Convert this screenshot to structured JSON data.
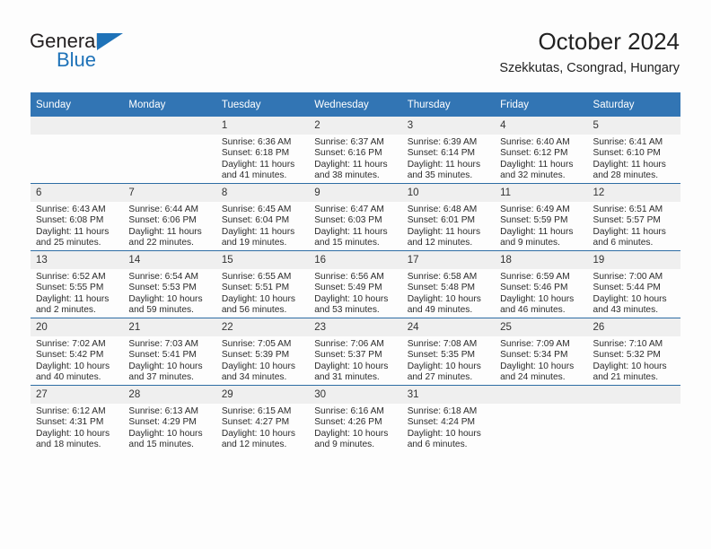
{
  "brand": {
    "name_top": "General",
    "name_bottom": "Blue",
    "accent_color": "#1e72b8"
  },
  "header": {
    "title": "October 2024",
    "subtitle": "Szekkutas, Csongrad, Hungary"
  },
  "theme": {
    "header_bg": "#3275b4",
    "row_divider": "#2e6da4",
    "daynum_bg": "#efefef",
    "page_bg": "#fdfdfd"
  },
  "labels": {
    "sunrise_prefix": "Sunrise:",
    "sunset_prefix": "Sunset:",
    "daylight_prefix": "Daylight:"
  },
  "weekdays": [
    "Sunday",
    "Monday",
    "Tuesday",
    "Wednesday",
    "Thursday",
    "Friday",
    "Saturday"
  ],
  "weeks": [
    [
      {
        "day": "",
        "sunrise": "",
        "sunset": "",
        "daylight_line1": "",
        "daylight_line2": ""
      },
      {
        "day": "",
        "sunrise": "",
        "sunset": "",
        "daylight_line1": "",
        "daylight_line2": ""
      },
      {
        "day": "1",
        "sunrise": "Sunrise: 6:36 AM",
        "sunset": "Sunset: 6:18 PM",
        "daylight_line1": "Daylight: 11 hours",
        "daylight_line2": "and 41 minutes."
      },
      {
        "day": "2",
        "sunrise": "Sunrise: 6:37 AM",
        "sunset": "Sunset: 6:16 PM",
        "daylight_line1": "Daylight: 11 hours",
        "daylight_line2": "and 38 minutes."
      },
      {
        "day": "3",
        "sunrise": "Sunrise: 6:39 AM",
        "sunset": "Sunset: 6:14 PM",
        "daylight_line1": "Daylight: 11 hours",
        "daylight_line2": "and 35 minutes."
      },
      {
        "day": "4",
        "sunrise": "Sunrise: 6:40 AM",
        "sunset": "Sunset: 6:12 PM",
        "daylight_line1": "Daylight: 11 hours",
        "daylight_line2": "and 32 minutes."
      },
      {
        "day": "5",
        "sunrise": "Sunrise: 6:41 AM",
        "sunset": "Sunset: 6:10 PM",
        "daylight_line1": "Daylight: 11 hours",
        "daylight_line2": "and 28 minutes."
      }
    ],
    [
      {
        "day": "6",
        "sunrise": "Sunrise: 6:43 AM",
        "sunset": "Sunset: 6:08 PM",
        "daylight_line1": "Daylight: 11 hours",
        "daylight_line2": "and 25 minutes."
      },
      {
        "day": "7",
        "sunrise": "Sunrise: 6:44 AM",
        "sunset": "Sunset: 6:06 PM",
        "daylight_line1": "Daylight: 11 hours",
        "daylight_line2": "and 22 minutes."
      },
      {
        "day": "8",
        "sunrise": "Sunrise: 6:45 AM",
        "sunset": "Sunset: 6:04 PM",
        "daylight_line1": "Daylight: 11 hours",
        "daylight_line2": "and 19 minutes."
      },
      {
        "day": "9",
        "sunrise": "Sunrise: 6:47 AM",
        "sunset": "Sunset: 6:03 PM",
        "daylight_line1": "Daylight: 11 hours",
        "daylight_line2": "and 15 minutes."
      },
      {
        "day": "10",
        "sunrise": "Sunrise: 6:48 AM",
        "sunset": "Sunset: 6:01 PM",
        "daylight_line1": "Daylight: 11 hours",
        "daylight_line2": "and 12 minutes."
      },
      {
        "day": "11",
        "sunrise": "Sunrise: 6:49 AM",
        "sunset": "Sunset: 5:59 PM",
        "daylight_line1": "Daylight: 11 hours",
        "daylight_line2": "and 9 minutes."
      },
      {
        "day": "12",
        "sunrise": "Sunrise: 6:51 AM",
        "sunset": "Sunset: 5:57 PM",
        "daylight_line1": "Daylight: 11 hours",
        "daylight_line2": "and 6 minutes."
      }
    ],
    [
      {
        "day": "13",
        "sunrise": "Sunrise: 6:52 AM",
        "sunset": "Sunset: 5:55 PM",
        "daylight_line1": "Daylight: 11 hours",
        "daylight_line2": "and 2 minutes."
      },
      {
        "day": "14",
        "sunrise": "Sunrise: 6:54 AM",
        "sunset": "Sunset: 5:53 PM",
        "daylight_line1": "Daylight: 10 hours",
        "daylight_line2": "and 59 minutes."
      },
      {
        "day": "15",
        "sunrise": "Sunrise: 6:55 AM",
        "sunset": "Sunset: 5:51 PM",
        "daylight_line1": "Daylight: 10 hours",
        "daylight_line2": "and 56 minutes."
      },
      {
        "day": "16",
        "sunrise": "Sunrise: 6:56 AM",
        "sunset": "Sunset: 5:49 PM",
        "daylight_line1": "Daylight: 10 hours",
        "daylight_line2": "and 53 minutes."
      },
      {
        "day": "17",
        "sunrise": "Sunrise: 6:58 AM",
        "sunset": "Sunset: 5:48 PM",
        "daylight_line1": "Daylight: 10 hours",
        "daylight_line2": "and 49 minutes."
      },
      {
        "day": "18",
        "sunrise": "Sunrise: 6:59 AM",
        "sunset": "Sunset: 5:46 PM",
        "daylight_line1": "Daylight: 10 hours",
        "daylight_line2": "and 46 minutes."
      },
      {
        "day": "19",
        "sunrise": "Sunrise: 7:00 AM",
        "sunset": "Sunset: 5:44 PM",
        "daylight_line1": "Daylight: 10 hours",
        "daylight_line2": "and 43 minutes."
      }
    ],
    [
      {
        "day": "20",
        "sunrise": "Sunrise: 7:02 AM",
        "sunset": "Sunset: 5:42 PM",
        "daylight_line1": "Daylight: 10 hours",
        "daylight_line2": "and 40 minutes."
      },
      {
        "day": "21",
        "sunrise": "Sunrise: 7:03 AM",
        "sunset": "Sunset: 5:41 PM",
        "daylight_line1": "Daylight: 10 hours",
        "daylight_line2": "and 37 minutes."
      },
      {
        "day": "22",
        "sunrise": "Sunrise: 7:05 AM",
        "sunset": "Sunset: 5:39 PM",
        "daylight_line1": "Daylight: 10 hours",
        "daylight_line2": "and 34 minutes."
      },
      {
        "day": "23",
        "sunrise": "Sunrise: 7:06 AM",
        "sunset": "Sunset: 5:37 PM",
        "daylight_line1": "Daylight: 10 hours",
        "daylight_line2": "and 31 minutes."
      },
      {
        "day": "24",
        "sunrise": "Sunrise: 7:08 AM",
        "sunset": "Sunset: 5:35 PM",
        "daylight_line1": "Daylight: 10 hours",
        "daylight_line2": "and 27 minutes."
      },
      {
        "day": "25",
        "sunrise": "Sunrise: 7:09 AM",
        "sunset": "Sunset: 5:34 PM",
        "daylight_line1": "Daylight: 10 hours",
        "daylight_line2": "and 24 minutes."
      },
      {
        "day": "26",
        "sunrise": "Sunrise: 7:10 AM",
        "sunset": "Sunset: 5:32 PM",
        "daylight_line1": "Daylight: 10 hours",
        "daylight_line2": "and 21 minutes."
      }
    ],
    [
      {
        "day": "27",
        "sunrise": "Sunrise: 6:12 AM",
        "sunset": "Sunset: 4:31 PM",
        "daylight_line1": "Daylight: 10 hours",
        "daylight_line2": "and 18 minutes."
      },
      {
        "day": "28",
        "sunrise": "Sunrise: 6:13 AM",
        "sunset": "Sunset: 4:29 PM",
        "daylight_line1": "Daylight: 10 hours",
        "daylight_line2": "and 15 minutes."
      },
      {
        "day": "29",
        "sunrise": "Sunrise: 6:15 AM",
        "sunset": "Sunset: 4:27 PM",
        "daylight_line1": "Daylight: 10 hours",
        "daylight_line2": "and 12 minutes."
      },
      {
        "day": "30",
        "sunrise": "Sunrise: 6:16 AM",
        "sunset": "Sunset: 4:26 PM",
        "daylight_line1": "Daylight: 10 hours",
        "daylight_line2": "and 9 minutes."
      },
      {
        "day": "31",
        "sunrise": "Sunrise: 6:18 AM",
        "sunset": "Sunset: 4:24 PM",
        "daylight_line1": "Daylight: 10 hours",
        "daylight_line2": "and 6 minutes."
      },
      {
        "day": "",
        "sunrise": "",
        "sunset": "",
        "daylight_line1": "",
        "daylight_line2": ""
      },
      {
        "day": "",
        "sunrise": "",
        "sunset": "",
        "daylight_line1": "",
        "daylight_line2": ""
      }
    ]
  ]
}
